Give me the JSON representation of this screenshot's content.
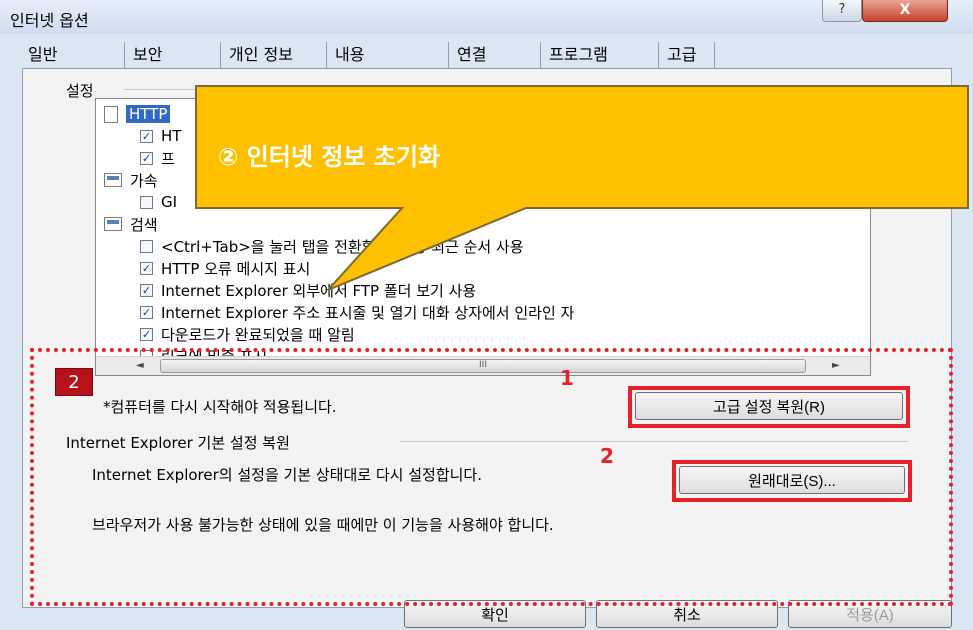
{
  "window": {
    "title": "인터넷 옵션",
    "help_label": "?",
    "close_label": "X"
  },
  "tabs": [
    "일반",
    "보안",
    "개인 정보",
    "내용",
    "연결",
    "프로그램",
    "고급"
  ],
  "active_tab": "고급",
  "settings": {
    "label": "설정",
    "tree": [
      {
        "kind": "category",
        "icon": "document-icon",
        "text": "HTTP"
      },
      {
        "kind": "option",
        "checked": true,
        "text": "HT"
      },
      {
        "kind": "option",
        "checked": true,
        "text": "프"
      },
      {
        "kind": "category",
        "icon": "display-icon",
        "text": "가속"
      },
      {
        "kind": "option",
        "checked": false,
        "text": "GI"
      },
      {
        "kind": "category",
        "icon": "search-icon",
        "text": "검색"
      },
      {
        "kind": "option",
        "checked": false,
        "text": "<Ctrl+Tab>을 눌러 탭을 전환할 때 가장 최근 순서 사용"
      },
      {
        "kind": "option",
        "checked": true,
        "text": "HTTP 오류 메시지 표시"
      },
      {
        "kind": "option",
        "checked": true,
        "text": "Internet Explorer 외부에서 FTP 폴더 보기 사용"
      },
      {
        "kind": "option",
        "checked": true,
        "text": "Internet Explorer 주소 표시줄 및 열기 대화 상자에서 인라인 자"
      },
      {
        "kind": "option",
        "checked": true,
        "text": "다운로드가 완료되었을 때 알림"
      },
      {
        "kind": "option",
        "checked": false,
        "text": "링크에 밑줄 표시"
      }
    ],
    "scroll_left": "◄",
    "scroll_right": "►",
    "scroll_thumb": "III"
  },
  "restart_note": "*컴퓨터를 다시 시작해야 적용됩니다.",
  "restore_advanced_button": "고급 설정 복원(R)",
  "reset_section": {
    "label": "Internet Explorer 기본 설정 복원",
    "description": "Internet Explorer의 설정을 기본 상태대로 다시 설정합니다.",
    "reset_button": "원래대로(S)...",
    "warning": "브라우저가 사용 불가능한 상태에 있을 때에만 이 기능을 사용해야 합니다."
  },
  "footer": {
    "ok": "확인",
    "cancel": "취소",
    "apply": "적용(A)"
  },
  "annotations": {
    "callout": "② 인터넷 정보 초기화",
    "badge": "2",
    "marker_1": "1",
    "marker_2": "2",
    "highlight_color": "#e8202a",
    "callout_color": "#ffc000"
  }
}
